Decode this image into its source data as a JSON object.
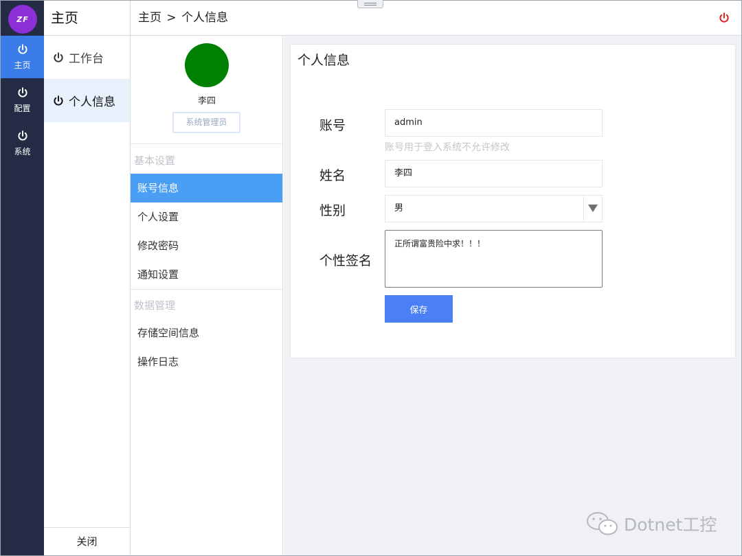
{
  "rail": {
    "logo_text": "ZF",
    "items": [
      {
        "label": "主页",
        "icon": "power-icon",
        "active": true
      },
      {
        "label": "配置",
        "icon": "power-icon",
        "active": false
      },
      {
        "label": "系统",
        "icon": "power-icon",
        "active": false
      }
    ]
  },
  "nav": {
    "title": "主页",
    "items": [
      {
        "label": "工作台",
        "icon": "power-icon",
        "active": false
      },
      {
        "label": "个人信息",
        "icon": "power-icon",
        "active": true
      }
    ],
    "close_label": "关闭"
  },
  "header": {
    "crumb_home": "主页",
    "crumb_sep": ">",
    "crumb_current": "个人信息",
    "power_icon_color": "#e02020"
  },
  "profile": {
    "avatar_color": "#008000",
    "name": "李四",
    "role": "系统管理员"
  },
  "settings": {
    "section1_title": "基本设置",
    "section1_items": [
      "账号信息",
      "个人设置",
      "修改密码",
      "通知设置"
    ],
    "active_item": "账号信息",
    "section2_title": "数据管理",
    "section2_items": [
      "存储空间信息",
      "操作日志"
    ]
  },
  "form": {
    "card_title": "个人信息",
    "account_label": "账号",
    "account_value": "admin",
    "account_hint": "账号用于登入系统不允许修改",
    "name_label": "姓名",
    "name_value": "李四",
    "gender_label": "性别",
    "gender_value": "男",
    "signature_label": "个性签名",
    "signature_value": "正所谓富贵险中求！！！",
    "save_label": "保存"
  },
  "watermark": {
    "text": "Dotnet工控"
  },
  "colors": {
    "rail_bg": "#232b45",
    "accent": "#3b7de8",
    "active_setting": "#4a9ff5",
    "save_button": "#4a7ff5"
  }
}
